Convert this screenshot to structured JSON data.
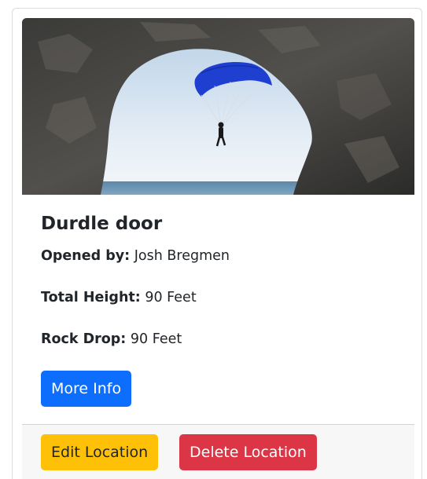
{
  "location": {
    "title": "Durdle door",
    "image_alt": "Paraglider flying through a rock arch over the sea",
    "opened_by_label": "Opened by:",
    "opened_by_value": "Josh Bregmen",
    "total_height_label": "Total Height:",
    "total_height_value": "90 Feet",
    "rock_drop_label": "Rock Drop:",
    "rock_drop_value": "90 Feet"
  },
  "actions": {
    "more_info_label": "More Info",
    "edit_label": "Edit Location",
    "delete_label": "Delete Location"
  },
  "colors": {
    "primary": "#0d6efd",
    "warning": "#ffc107",
    "danger": "#dc3545",
    "parachute": "#1f3fd1"
  }
}
